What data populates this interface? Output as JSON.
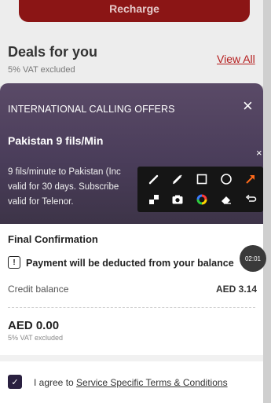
{
  "background": {
    "recharge_label": "Recharge",
    "deals_title": "Deals for you",
    "deals_subtitle": "5% VAT excluded",
    "view_all": "View All"
  },
  "offer": {
    "heading": "INTERNATIONAL CALLING OFFERS",
    "close_icon": "×",
    "title": "Pakistan 9 fils/Min",
    "description": "9 fils/minute to Pakistan (Inc\nvalid for 30 days. Subscribe\nvalid for Telenor."
  },
  "toolbar": {
    "close_icon": "×",
    "tools": [
      "pen-icon",
      "highlighter-icon",
      "rectangle-icon",
      "circle-icon",
      "arrow-icon",
      "mosaic-icon",
      "camera-icon",
      "color-wheel-icon",
      "eraser-icon",
      "undo-icon"
    ]
  },
  "confirmation": {
    "title": "Final Confirmation",
    "payment_notice": "Payment will be deducted from your balance",
    "timer": "02:01",
    "credit_label": "Credit balance",
    "credit_value": "AED 3.14",
    "total": "AED 0.00",
    "total_sub": "5% VAT excluded",
    "agree_prefix": "I agree to ",
    "agree_link": "Service Specific Terms & Conditions"
  },
  "colors": {
    "brand_red": "#b51d1d",
    "offer_bg": "#4a3d5a",
    "checkbox": "#2a2040"
  }
}
